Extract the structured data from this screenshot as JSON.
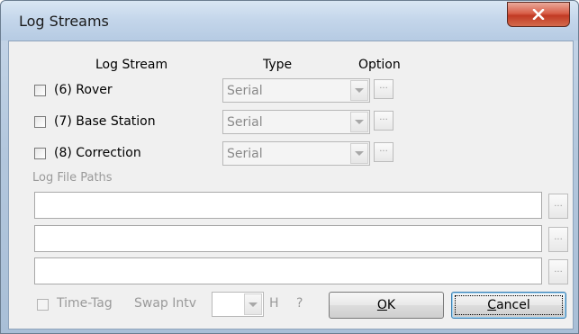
{
  "window": {
    "title": "Log Streams"
  },
  "header": {
    "log_stream": "Log Stream",
    "type": "Type",
    "option": "Option"
  },
  "streams": [
    {
      "label": "(6) Rover",
      "checked": false,
      "type": "Serial",
      "option": "..."
    },
    {
      "label": "(7) Base Station",
      "checked": false,
      "type": "Serial",
      "option": "..."
    },
    {
      "label": "(8) Correction",
      "checked": false,
      "type": "Serial",
      "option": "..."
    }
  ],
  "paths": {
    "label": "Log File Paths",
    "values": [
      "",
      "",
      ""
    ],
    "browse": "..."
  },
  "bottom": {
    "time_tag": "Time-Tag",
    "swap_intv": "Swap Intv",
    "swap_value": "",
    "unit": "H",
    "help": "?",
    "ok": "OK",
    "cancel": "Cancel"
  },
  "colors": {
    "disabled_text": "#9a9a9a",
    "close_button": "#c13a24",
    "dialog_bg": "#f0f0f0"
  }
}
